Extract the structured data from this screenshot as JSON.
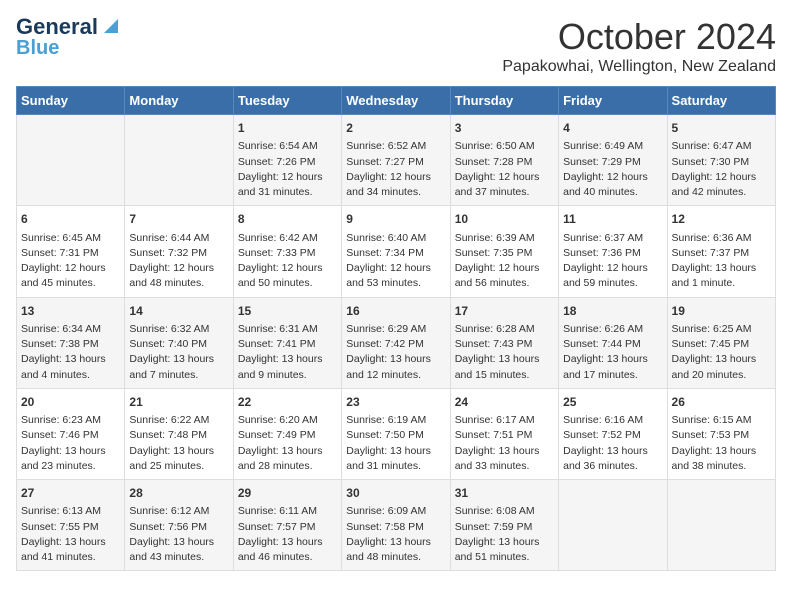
{
  "logo": {
    "line1": "General",
    "line2": "Blue"
  },
  "header": {
    "month": "October 2024",
    "location": "Papakowhai, Wellington, New Zealand"
  },
  "days_of_week": [
    "Sunday",
    "Monday",
    "Tuesday",
    "Wednesday",
    "Thursday",
    "Friday",
    "Saturday"
  ],
  "weeks": [
    [
      {
        "day": "",
        "info": ""
      },
      {
        "day": "",
        "info": ""
      },
      {
        "day": "1",
        "info": "Sunrise: 6:54 AM\nSunset: 7:26 PM\nDaylight: 12 hours and 31 minutes."
      },
      {
        "day": "2",
        "info": "Sunrise: 6:52 AM\nSunset: 7:27 PM\nDaylight: 12 hours and 34 minutes."
      },
      {
        "day": "3",
        "info": "Sunrise: 6:50 AM\nSunset: 7:28 PM\nDaylight: 12 hours and 37 minutes."
      },
      {
        "day": "4",
        "info": "Sunrise: 6:49 AM\nSunset: 7:29 PM\nDaylight: 12 hours and 40 minutes."
      },
      {
        "day": "5",
        "info": "Sunrise: 6:47 AM\nSunset: 7:30 PM\nDaylight: 12 hours and 42 minutes."
      }
    ],
    [
      {
        "day": "6",
        "info": "Sunrise: 6:45 AM\nSunset: 7:31 PM\nDaylight: 12 hours and 45 minutes."
      },
      {
        "day": "7",
        "info": "Sunrise: 6:44 AM\nSunset: 7:32 PM\nDaylight: 12 hours and 48 minutes."
      },
      {
        "day": "8",
        "info": "Sunrise: 6:42 AM\nSunset: 7:33 PM\nDaylight: 12 hours and 50 minutes."
      },
      {
        "day": "9",
        "info": "Sunrise: 6:40 AM\nSunset: 7:34 PM\nDaylight: 12 hours and 53 minutes."
      },
      {
        "day": "10",
        "info": "Sunrise: 6:39 AM\nSunset: 7:35 PM\nDaylight: 12 hours and 56 minutes."
      },
      {
        "day": "11",
        "info": "Sunrise: 6:37 AM\nSunset: 7:36 PM\nDaylight: 12 hours and 59 minutes."
      },
      {
        "day": "12",
        "info": "Sunrise: 6:36 AM\nSunset: 7:37 PM\nDaylight: 13 hours and 1 minute."
      }
    ],
    [
      {
        "day": "13",
        "info": "Sunrise: 6:34 AM\nSunset: 7:38 PM\nDaylight: 13 hours and 4 minutes."
      },
      {
        "day": "14",
        "info": "Sunrise: 6:32 AM\nSunset: 7:40 PM\nDaylight: 13 hours and 7 minutes."
      },
      {
        "day": "15",
        "info": "Sunrise: 6:31 AM\nSunset: 7:41 PM\nDaylight: 13 hours and 9 minutes."
      },
      {
        "day": "16",
        "info": "Sunrise: 6:29 AM\nSunset: 7:42 PM\nDaylight: 13 hours and 12 minutes."
      },
      {
        "day": "17",
        "info": "Sunrise: 6:28 AM\nSunset: 7:43 PM\nDaylight: 13 hours and 15 minutes."
      },
      {
        "day": "18",
        "info": "Sunrise: 6:26 AM\nSunset: 7:44 PM\nDaylight: 13 hours and 17 minutes."
      },
      {
        "day": "19",
        "info": "Sunrise: 6:25 AM\nSunset: 7:45 PM\nDaylight: 13 hours and 20 minutes."
      }
    ],
    [
      {
        "day": "20",
        "info": "Sunrise: 6:23 AM\nSunset: 7:46 PM\nDaylight: 13 hours and 23 minutes."
      },
      {
        "day": "21",
        "info": "Sunrise: 6:22 AM\nSunset: 7:48 PM\nDaylight: 13 hours and 25 minutes."
      },
      {
        "day": "22",
        "info": "Sunrise: 6:20 AM\nSunset: 7:49 PM\nDaylight: 13 hours and 28 minutes."
      },
      {
        "day": "23",
        "info": "Sunrise: 6:19 AM\nSunset: 7:50 PM\nDaylight: 13 hours and 31 minutes."
      },
      {
        "day": "24",
        "info": "Sunrise: 6:17 AM\nSunset: 7:51 PM\nDaylight: 13 hours and 33 minutes."
      },
      {
        "day": "25",
        "info": "Sunrise: 6:16 AM\nSunset: 7:52 PM\nDaylight: 13 hours and 36 minutes."
      },
      {
        "day": "26",
        "info": "Sunrise: 6:15 AM\nSunset: 7:53 PM\nDaylight: 13 hours and 38 minutes."
      }
    ],
    [
      {
        "day": "27",
        "info": "Sunrise: 6:13 AM\nSunset: 7:55 PM\nDaylight: 13 hours and 41 minutes."
      },
      {
        "day": "28",
        "info": "Sunrise: 6:12 AM\nSunset: 7:56 PM\nDaylight: 13 hours and 43 minutes."
      },
      {
        "day": "29",
        "info": "Sunrise: 6:11 AM\nSunset: 7:57 PM\nDaylight: 13 hours and 46 minutes."
      },
      {
        "day": "30",
        "info": "Sunrise: 6:09 AM\nSunset: 7:58 PM\nDaylight: 13 hours and 48 minutes."
      },
      {
        "day": "31",
        "info": "Sunrise: 6:08 AM\nSunset: 7:59 PM\nDaylight: 13 hours and 51 minutes."
      },
      {
        "day": "",
        "info": ""
      },
      {
        "day": "",
        "info": ""
      }
    ]
  ]
}
